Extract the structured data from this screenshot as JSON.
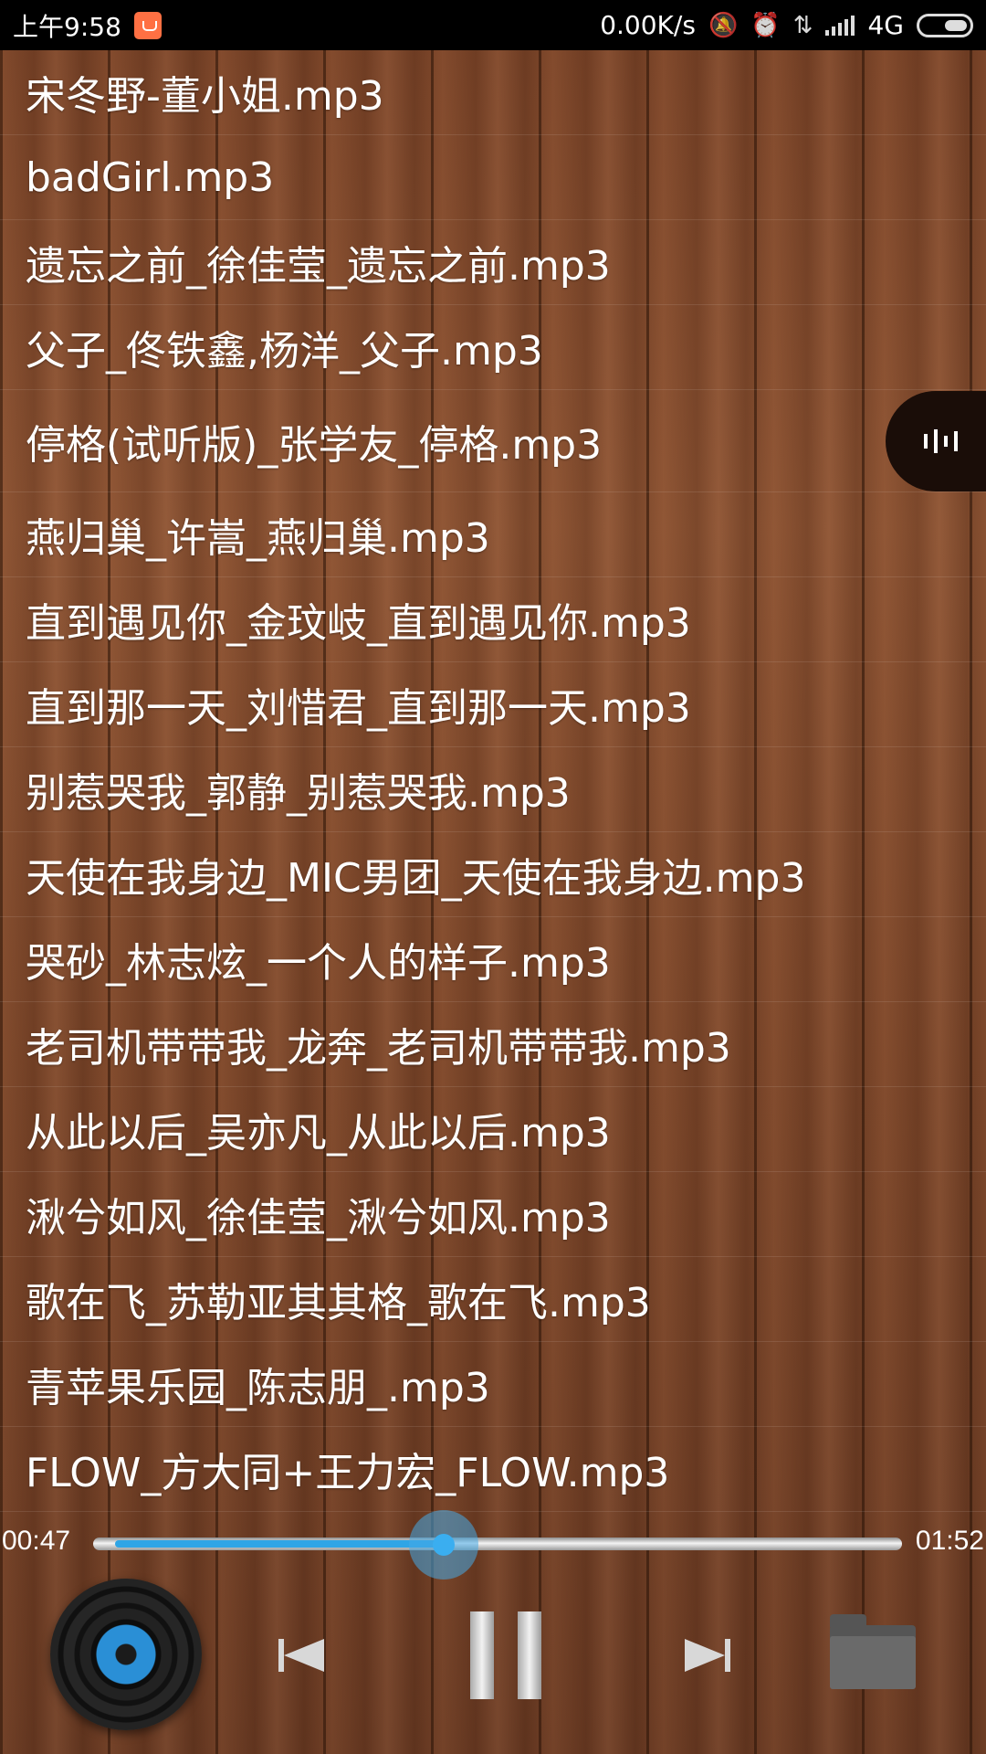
{
  "status_bar": {
    "time": "上午9:58",
    "app_icon": "mi-store-icon",
    "speed": "0.00K/s",
    "network": "4G",
    "icons": [
      "mute-bell-icon",
      "alarm-icon",
      "data-transfer-icon",
      "signal-icon",
      "battery-icon"
    ]
  },
  "songs": [
    "宋冬野-董小姐.mp3",
    "badGirl.mp3",
    "遗忘之前_徐佳莹_遗忘之前.mp3",
    "父子_佟铁鑫,杨洋_父子.mp3",
    "停格(试听版)_张学友_停格.mp3",
    "燕归巢_许嵩_燕归巢.mp3",
    "直到遇见你_金玟岐_直到遇见你.mp3",
    "直到那一天_刘惜君_直到那一天.mp3",
    "别惹哭我_郭静_别惹哭我.mp3",
    "天使在我身边_MIC男团_天使在我身边.mp3",
    "哭砂_林志炫_一个人的样子.mp3",
    "老司机带带我_龙奔_老司机带带我.mp3",
    "从此以后_吴亦凡_从此以后.mp3",
    "湫兮如风_徐佳莹_湫兮如风.mp3",
    "歌在飞_苏勒亚其其格_歌在飞.mp3",
    "青苹果乐园_陈志朋_.mp3",
    "FLOW_方大同+王力宏_FLOW.mp3"
  ],
  "player": {
    "current_time": "00:47",
    "total_time": "01:52",
    "progress": 0.42,
    "accent_color": "#2fa5e6",
    "controls": [
      "vinyl-disc-icon",
      "previous-icon",
      "pause-icon",
      "next-icon",
      "folder-icon"
    ]
  }
}
